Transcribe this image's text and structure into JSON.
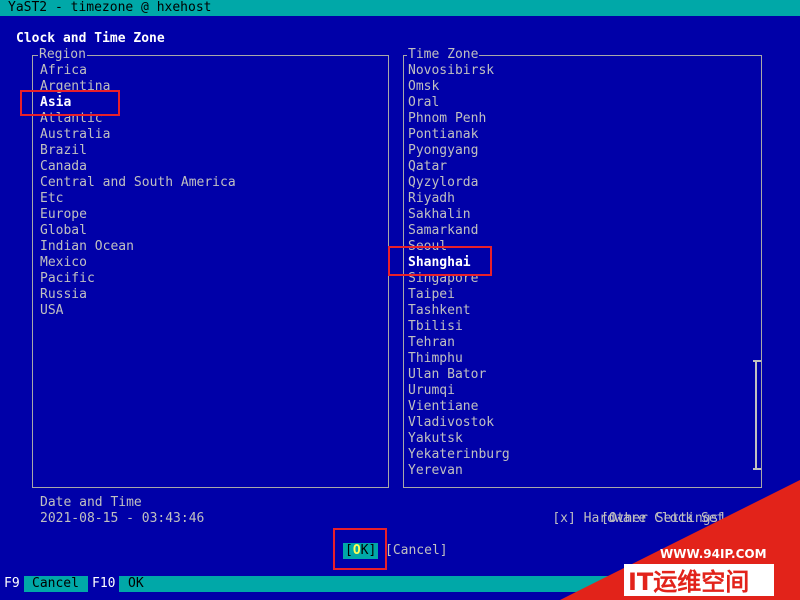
{
  "window": {
    "title": "YaST2 - timezone @ hxehost"
  },
  "dialog": {
    "heading": "Clock and Time Zone"
  },
  "region": {
    "label": "Region",
    "selected": "Asia",
    "items": [
      "Africa",
      "Argentina",
      "Asia",
      "Atlantic",
      "Australia",
      "Brazil",
      "Canada",
      "Central and South America",
      "Etc",
      "Europe",
      "Global",
      "Indian Ocean",
      "Mexico",
      "Pacific",
      "Russia",
      "USA"
    ]
  },
  "timezone": {
    "label": "Time Zone",
    "selected": "Shanghai",
    "items": [
      "Novosibirsk",
      "Omsk",
      "Oral",
      "Phnom Penh",
      "Pontianak",
      "Pyongyang",
      "Qatar",
      "Qyzylorda",
      "Riyadh",
      "Sakhalin",
      "Samarkand",
      "Seoul",
      "Shanghai",
      "Singapore",
      "Taipei",
      "Tashkent",
      "Tbilisi",
      "Tehran",
      "Thimphu",
      "Ulan Bator",
      "Urumqi",
      "Vientiane",
      "Vladivostok",
      "Yakutsk",
      "Yekaterinburg",
      "Yerevan"
    ]
  },
  "datetime": {
    "label": "Date and Time",
    "value": "2021-08-15 - 03:43:46"
  },
  "hardware_clock": {
    "checkbox": "[x]",
    "label": "Hardware Clock Set to UTC"
  },
  "other_settings": {
    "label": "[Other Settings]"
  },
  "buttons": {
    "ok_open": "[",
    "ok_hot": "O",
    "ok_rest": "K]",
    "cancel": "[Cancel]"
  },
  "footer": {
    "f9_key": "F9",
    "f9_label": "Cancel",
    "f10_key": "F10",
    "f10_label": "OK"
  },
  "watermark": {
    "url": "WWW.94IP.COM",
    "brand": "IT运维空间"
  },
  "colors": {
    "background": "#0000a8",
    "bar": "#00a8a8",
    "text": "#c0c0c0",
    "highlight_box": "#e8202a",
    "watermark_red": "#e2231a"
  }
}
